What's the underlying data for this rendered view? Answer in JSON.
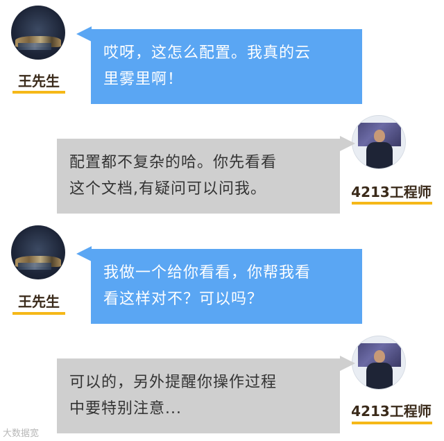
{
  "participants": {
    "customer": {
      "name": "王先生",
      "avatar_icon": "city-night-avatar"
    },
    "engineer": {
      "name": "4213工程师",
      "avatar_icon": "engineer-photo-avatar"
    }
  },
  "messages": [
    {
      "sender": "customer",
      "lines": [
        "哎呀，这怎么配置。我真的云",
        "里雾里啊！"
      ]
    },
    {
      "sender": "engineer",
      "lines": [
        "配置都不复杂的哈。你先看看",
        "这个文档,有疑问可以问我。"
      ]
    },
    {
      "sender": "customer",
      "lines": [
        "我做一个给你看看，你帮我看",
        "看这样对不？可以吗？"
      ]
    },
    {
      "sender": "engineer",
      "lines": [
        "可以的，另外提醒你操作过程",
        "中要特别注意..."
      ]
    }
  ],
  "watermark": "大数据宽",
  "colors": {
    "customer_bubble": "#5aa6f3",
    "engineer_bubble": "#cfcfcf",
    "accent_underline": "#f5b818"
  }
}
